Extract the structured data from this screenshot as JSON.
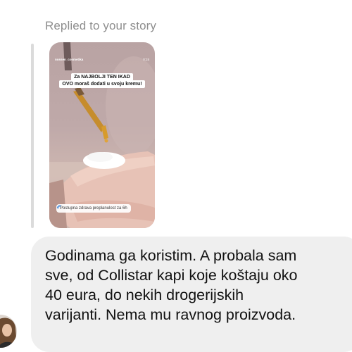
{
  "reply_context": {
    "label": "Replied to your story"
  },
  "story": {
    "handle": "nossen_cosmetika",
    "time": "0:15",
    "caption_line1": "Za NAJBOLJI TEN IKAD",
    "caption_line2": "OVO moraš dodati u svoju kremu!",
    "footer_text": "Postupna zdrava preplanulost za 6h",
    "footer_icon": "link-icon"
  },
  "message": {
    "lines": [
      "Godinama ga koristim. A probala sam",
      "sve, od Collistar kapi koje koštaju oko",
      "40 eura, do nekih drogerijskih",
      "varijanti. Nema mu ravnog proizvoda."
    ]
  },
  "sender": {
    "avatar_icon": "profile-avatar"
  }
}
